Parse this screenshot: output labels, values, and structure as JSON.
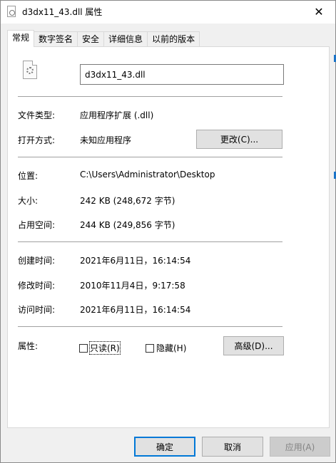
{
  "window": {
    "title": "d3dx11_43.dll 属性",
    "close_glyph": "✕"
  },
  "tabs": [
    {
      "label": "常规",
      "active": true
    },
    {
      "label": "数字签名"
    },
    {
      "label": "安全"
    },
    {
      "label": "详细信息"
    },
    {
      "label": "以前的版本"
    }
  ],
  "general": {
    "file_name": "d3dx11_43.dll",
    "file_type_label": "文件类型:",
    "file_type_value": "应用程序扩展 (.dll)",
    "opens_with_label": "打开方式:",
    "opens_with_value": "未知应用程序",
    "change_button": "更改(C)...",
    "location_label": "位置:",
    "location_value": "C:\\Users\\Administrator\\Desktop",
    "size_label": "大小:",
    "size_value": "242 KB (248,672 字节)",
    "size_on_disk_label": "占用空间:",
    "size_on_disk_value": "244 KB (249,856 字节)",
    "created_label": "创建时间:",
    "created_value": "2021年6月11日，16:14:54",
    "modified_label": "修改时间:",
    "modified_value": "2010年11月4日，9:17:58",
    "accessed_label": "访问时间:",
    "accessed_value": "2021年6月11日，16:14:54",
    "attributes_label": "属性:",
    "readonly_label": "只读(R)",
    "readonly_checked": false,
    "hidden_label": "隐藏(H)",
    "hidden_checked": false,
    "advanced_button": "高级(D)..."
  },
  "footer": {
    "ok_button": "确定",
    "cancel_button": "取消",
    "apply_button": "应用(A)"
  },
  "colors": {
    "accent": "#0078d7",
    "panel_bg": "#ffffff",
    "window_bg": "#f0f0f0"
  }
}
